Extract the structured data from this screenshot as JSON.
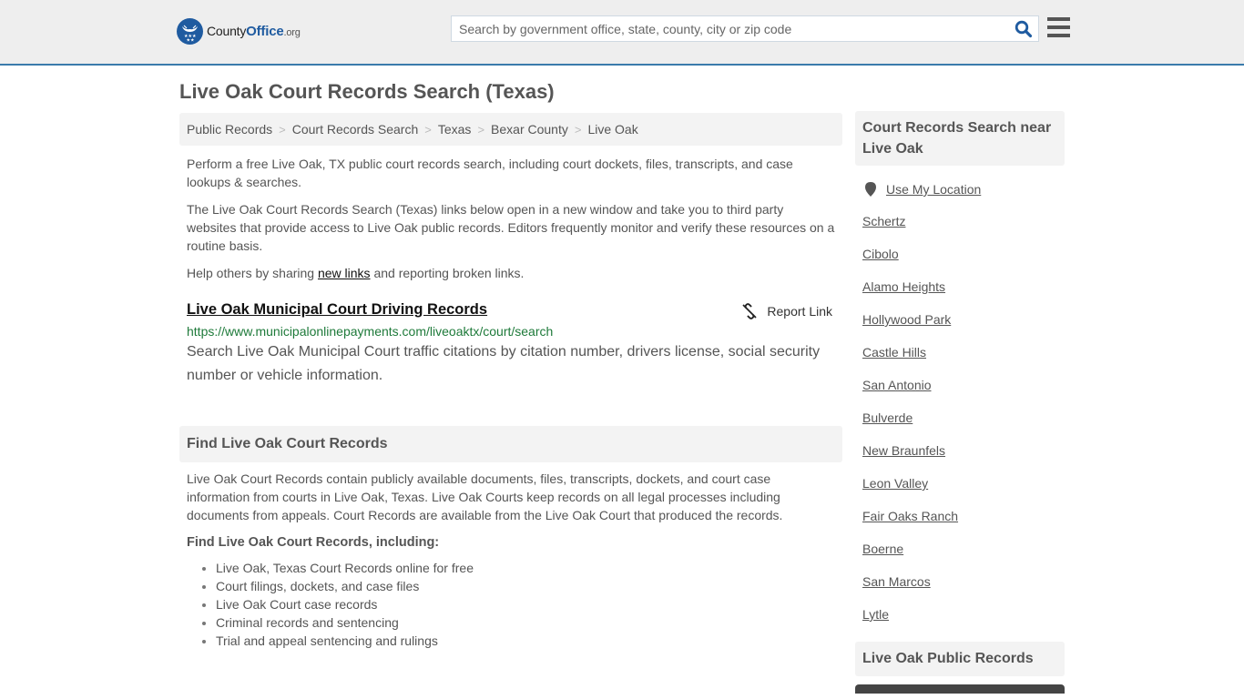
{
  "header": {
    "logo": {
      "prefix": "County",
      "brand": "Office",
      "suffix": ".org"
    },
    "search": {
      "placeholder": "Search by government office, state, county, city or zip code",
      "value": ""
    },
    "search_icon": "search-icon",
    "menu_icon": "hamburger-menu-icon",
    "colors": {
      "brand": "#1f5ba0",
      "header_bg": "#eeeeee",
      "header_border": "#3a7bab"
    }
  },
  "page": {
    "title": "Live Oak Court Records Search (Texas)"
  },
  "breadcrumb": [
    {
      "label": "Public Records"
    },
    {
      "label": "Court Records Search"
    },
    {
      "label": "Texas"
    },
    {
      "label": "Bexar County"
    },
    {
      "label": "Live Oak"
    }
  ],
  "breadcrumb_sep": ">",
  "intro": {
    "p1": "Perform a free Live Oak, TX public court records search, including court dockets, files, transcripts, and case lookups & searches.",
    "p2": "The Live Oak Court Records Search (Texas) links below open in a new window and take you to third party websites that provide access to Live Oak public records. Editors frequently monitor and verify these resources on a routine basis.",
    "p3_before": "Help others by sharing ",
    "p3_link": "new links",
    "p3_after": " and reporting broken links."
  },
  "results": [
    {
      "title": "Live Oak Municipal Court Driving Records",
      "url": "https://www.municipalonlinepayments.com/liveoaktx/court/search",
      "description": "Search Live Oak Municipal Court traffic citations by citation number, drivers license, social security number or vehicle information.",
      "report_label": "Report Link"
    }
  ],
  "find_section": {
    "heading": "Find Live Oak Court Records",
    "body": "Live Oak Court Records contain publicly available documents, files, transcripts, dockets, and court case information from courts in Live Oak, Texas. Live Oak Courts keep records on all legal processes including documents from appeals. Court Records are available from the Live Oak Court that produced the records.",
    "subheading": "Find Live Oak Court Records, including:",
    "items": [
      "Live Oak, Texas Court Records online for free",
      "Court filings, dockets, and case files",
      "Live Oak Court case records",
      "Criminal records and sentencing",
      "Trial and appeal sentencing and rulings"
    ]
  },
  "sidebar": {
    "heading": "Court Records Search near Live Oak",
    "use_location": "Use My Location",
    "nearby": [
      "Schertz",
      "Cibolo",
      "Alamo Heights",
      "Hollywood Park",
      "Castle Hills",
      "San Antonio",
      "Bulverde",
      "New Braunfels",
      "Leon Valley",
      "Fair Oaks Ranch",
      "Boerne",
      "San Marcos",
      "Lytle"
    ],
    "heading2": "Live Oak Public Records"
  }
}
